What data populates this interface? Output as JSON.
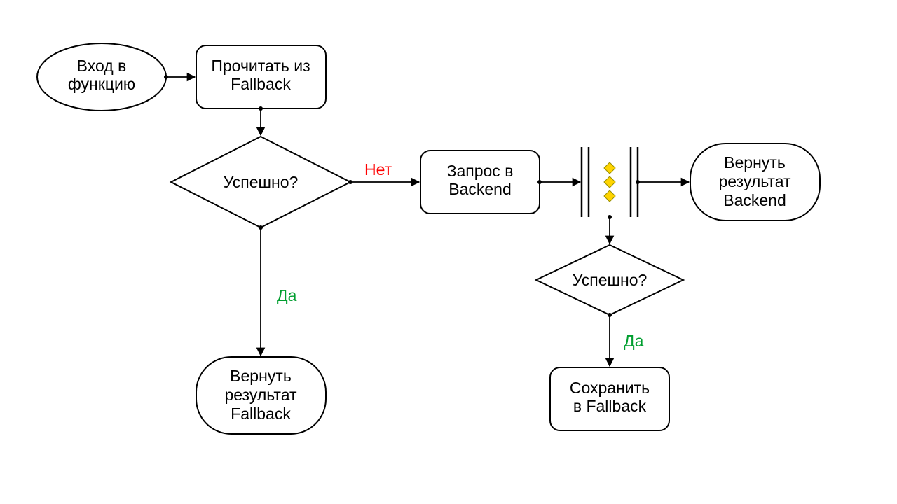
{
  "nodes": {
    "start": {
      "line1": "Вход в",
      "line2": "функцию"
    },
    "readFallback": {
      "line1": "Прочитать из",
      "line2": "Fallback"
    },
    "success1": {
      "label": "Успешно?"
    },
    "resultFallback": {
      "line1": "Вернуть",
      "line2": "результат",
      "line3": "Fallback"
    },
    "backendReq": {
      "line1": "Запрос в",
      "line2": "Backend"
    },
    "success2": {
      "label": "Успешно?"
    },
    "saveFallback": {
      "line1": "Сохранить",
      "line2": "в Fallback"
    },
    "resultBackend": {
      "line1": "Вернуть",
      "line2": "результат",
      "line3": "Backend"
    }
  },
  "labels": {
    "yes": "Да",
    "no": "Нет"
  }
}
